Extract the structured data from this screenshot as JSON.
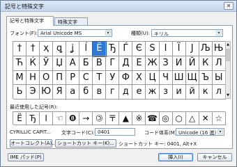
{
  "window": {
    "title": "記号と特殊文字"
  },
  "close_icon": "✕",
  "tabs": [
    "記号と特殊文字",
    "特殊文字"
  ],
  "font": {
    "label": "フォント(F):",
    "value": "Arial Unicode MS"
  },
  "subset": {
    "label": "種類(U):",
    "value": "キリル"
  },
  "symbols": [
    [
      "†",
      "†",
      "ҳ",
      "ꝗ",
      "ʝ",
      "ĺ",
      "Ë",
      "Ђ",
      "Ѓ",
      "Є",
      "Ѕ",
      "І",
      "Ї",
      "Ј",
      "Љ",
      "Њ"
    ],
    [
      "Ћ",
      "Ќ",
      "Ў",
      "Џ",
      "А",
      "Б",
      "В",
      "Г",
      "Д",
      "Е",
      "Ж",
      "З",
      "И",
      "Й",
      "К",
      "Л"
    ],
    [
      "М",
      "Н",
      "О",
      "П",
      "Р",
      "С",
      "Т",
      "У",
      "Ф",
      "Х",
      "Ц",
      "Ч",
      "Ш",
      "Щ",
      "Ъ",
      "Ы"
    ],
    [
      "Ь",
      "Э",
      "Ю",
      "Я",
      "а",
      "б",
      "в",
      "г",
      "д",
      "е",
      "ж",
      "з",
      "и",
      "й",
      "к",
      "л"
    ]
  ],
  "recent": {
    "label": "最近使用した記号(R):",
    "items": [
      "Ë",
      "Ђ",
      "I",
      "☜",
      "❽",
      "→",
      "🄯",
      "〒",
      "▲",
      "※",
      "☎",
      "◎",
      "○",
      "△",
      "✕",
      "☆"
    ]
  },
  "character_name": "CYRILLIC CAPIT...",
  "char_code": {
    "label": "文字コード(C):",
    "value": "0401"
  },
  "code_system": {
    "label": "コード体系(M):",
    "value": "Unicode (16 進)"
  },
  "buttons": {
    "autocorrect": "オートコレクト(A)...",
    "shortcut_key": "ショートカット キー(K)...",
    "shortcut_text": "ショートカット キー: 0401, Alt+X",
    "ime_pad": "IME パッド(P)",
    "insert": "挿入(I)",
    "cancel": "キャンセル"
  }
}
